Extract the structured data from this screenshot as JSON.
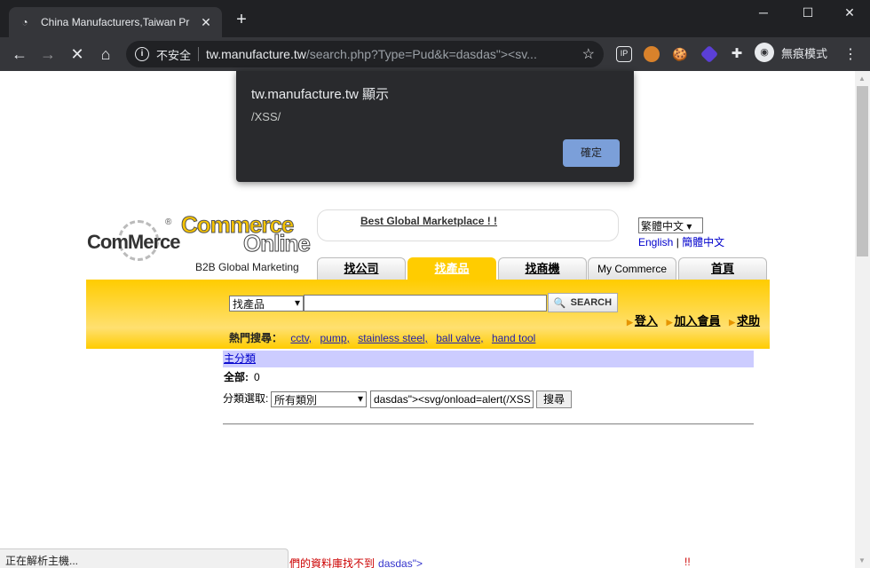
{
  "browser": {
    "tab_title": "China Manufacturers,Taiwan Pr",
    "tab_close": "✕",
    "new_tab": "+",
    "win_minimize": "─",
    "win_maximize": "☐",
    "win_close": "✕",
    "back": "←",
    "forward": "→",
    "stop": "✕",
    "home": "⌂",
    "insecure_label": "不安全",
    "url_host": "tw.manufacture.tw",
    "url_rest": "/search.php?Type=Pud&k=dasdas\"><sv...",
    "incognito_label": "無痕模式",
    "extensions": [
      "IP",
      "🍪"
    ],
    "status": "正在解析主機..."
  },
  "dialog": {
    "title": "tw.manufacture.tw 顯示",
    "message": "/XSS/",
    "ok_label": "確定"
  },
  "site": {
    "logo_text": "ComMerce",
    "brand_line1": "Commerce",
    "brand_line2": "Online",
    "registered": "®",
    "tagline": "B2B Global Marketing",
    "bubble_text": "Best Global Marketplace ! !",
    "lang_select": "繁體中文 ▾",
    "lang_english": "English",
    "lang_separator": " | ",
    "lang_simplified": "簡體中文",
    "tabs": [
      {
        "label": "找公司"
      },
      {
        "label": "找產品"
      },
      {
        "label": "找商機"
      },
      {
        "label": "My Commerce"
      },
      {
        "label": "首頁"
      }
    ],
    "search": {
      "type_value": "找產品",
      "query_value": "",
      "button_label": "SEARCH"
    },
    "member": {
      "login": "登入",
      "join": "加入會員",
      "help": "求助"
    },
    "hot": {
      "label": "熱門搜尋：",
      "terms": [
        "cctv,",
        "pump,",
        "stainless steel,",
        "ball valve,",
        "hand tool"
      ]
    },
    "category_link": "主分類",
    "total_label": "全部:",
    "total_value": "0",
    "filter_label": "分類選取:",
    "category_select": "所有類別",
    "keyword_value": "dasdas\"><svg/onload=alert(/XSS",
    "keyword_button": "搜尋",
    "bottom_text": "們的資料庫找不到",
    "bottom_query": "dasdas\">",
    "bottom_bang": "!!"
  },
  "colors": {
    "accent_yellow": "#ffcc00",
    "dialog_button": "#8ab4f8",
    "category_bar": "#ccccff"
  }
}
